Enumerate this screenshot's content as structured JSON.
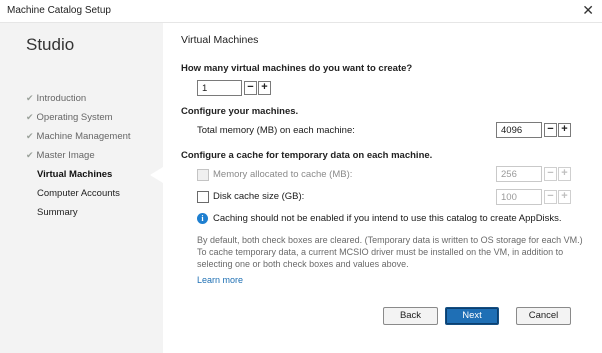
{
  "window": {
    "title": "Machine Catalog Setup",
    "close_glyph": "✕"
  },
  "sidebar": {
    "brand": "Studio",
    "steps": [
      {
        "label": "Introduction",
        "state": "done"
      },
      {
        "label": "Operating System",
        "state": "done"
      },
      {
        "label": "Machine Management",
        "state": "done"
      },
      {
        "label": "Master Image",
        "state": "done"
      },
      {
        "label": "Virtual Machines",
        "state": "current"
      },
      {
        "label": "Computer Accounts",
        "state": "todo"
      },
      {
        "label": "Summary",
        "state": "todo"
      }
    ],
    "check_glyph": "✔"
  },
  "main": {
    "title": "Virtual Machines",
    "vm_count": {
      "question": "How many virtual machines do you want to create?",
      "value": "1"
    },
    "configure": {
      "heading": "Configure your machines.",
      "memory_label": "Total memory (MB) on each machine:",
      "memory_value": "4096"
    },
    "cache": {
      "heading": "Configure a cache for temporary data on each machine.",
      "memory_label": "Memory allocated to cache (MB):",
      "memory_value": "256",
      "disk_label": "Disk cache size (GB):",
      "disk_value": "100"
    },
    "info": "Caching should not be enabled if you intend to use this catalog to create AppDisks.",
    "paragraph": "By default, both check boxes are cleared. (Temporary data is written to OS storage for each VM.) To cache temporary data, a current MCSIO driver must be installed on the VM, in addition to selecting one or both check boxes and values above.",
    "learn_more": "Learn more",
    "minus": "−",
    "plus": "+"
  },
  "buttons": {
    "back": "Back",
    "next": "Next",
    "cancel": "Cancel"
  },
  "colors": {
    "accent": "#1f6fb5",
    "sidebar_bg": "#f3f3f3",
    "info_icon": "#1e7fd0"
  }
}
